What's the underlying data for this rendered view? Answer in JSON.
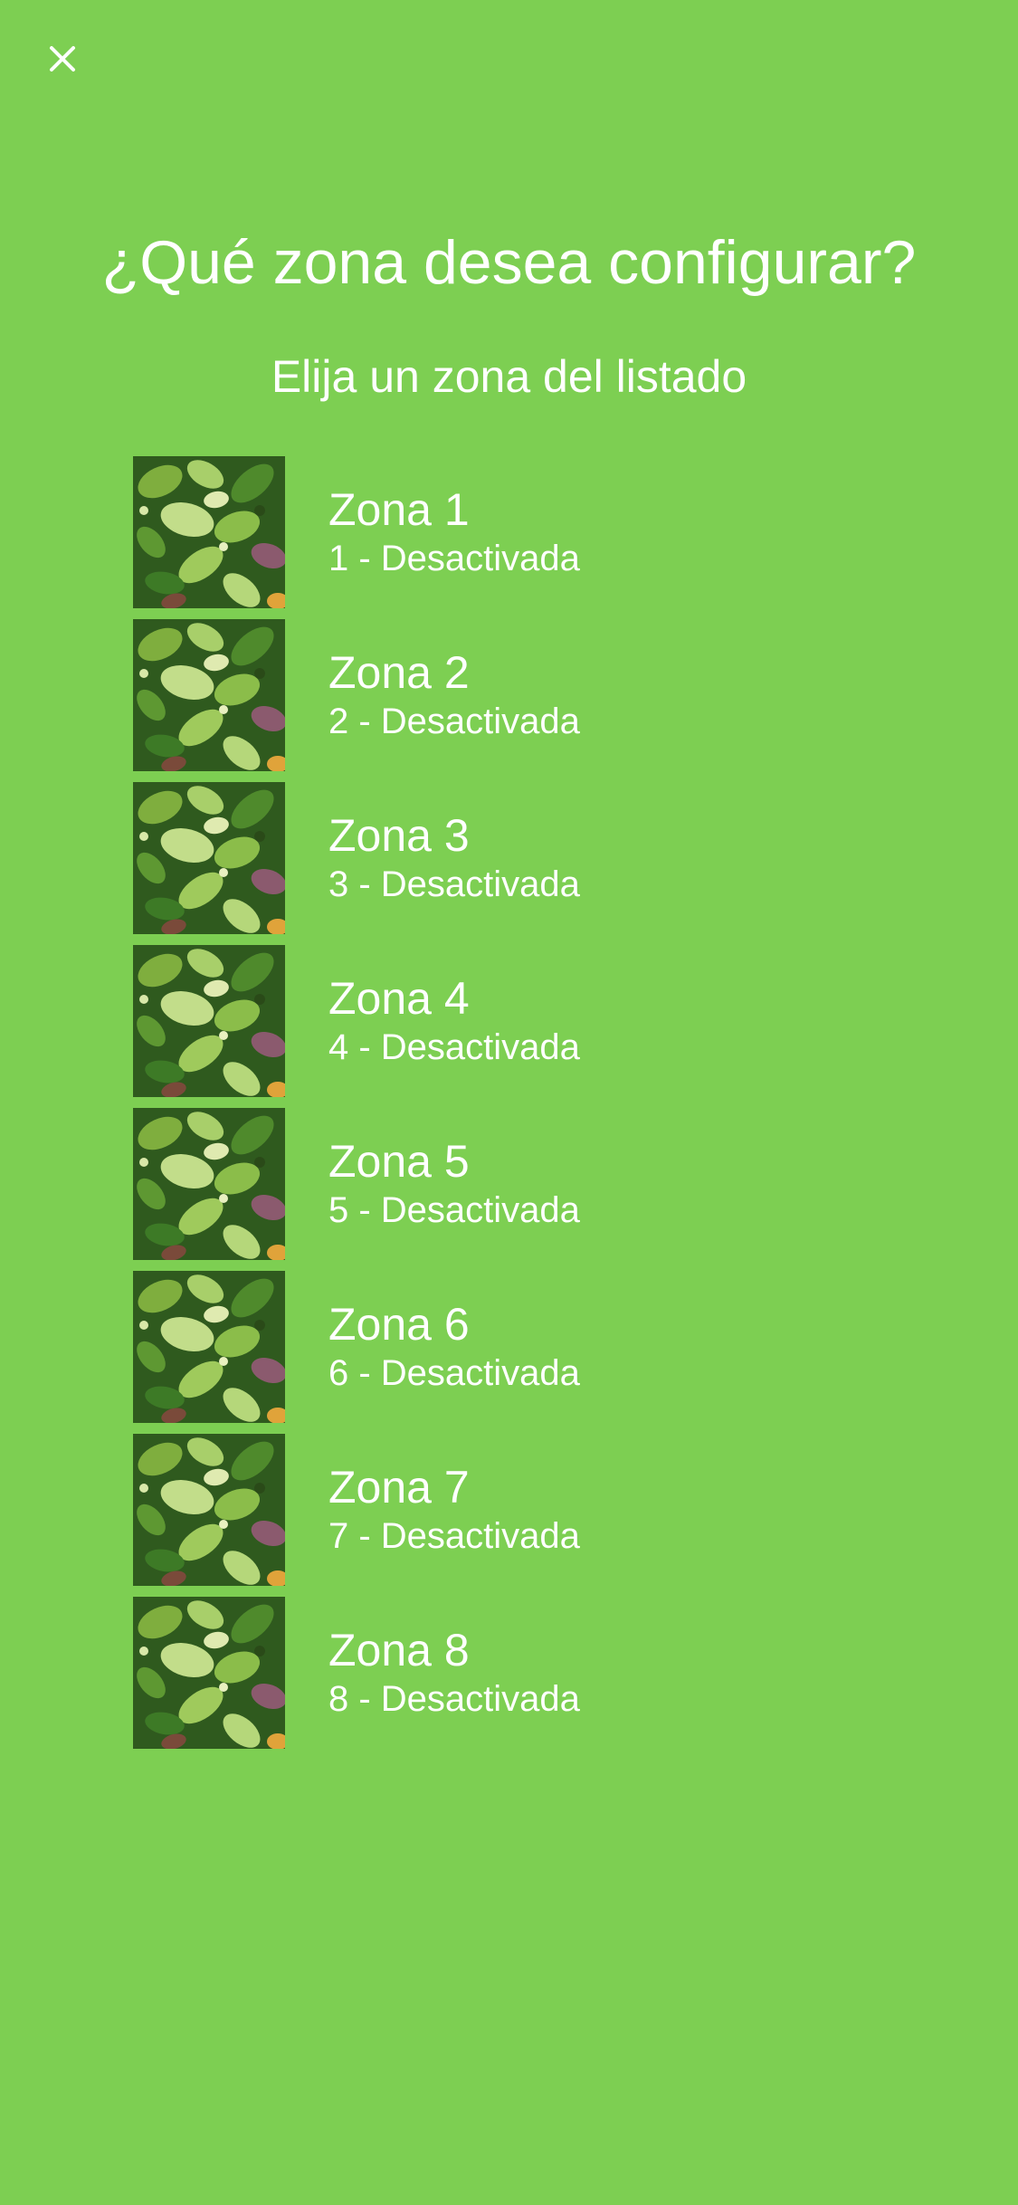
{
  "header": {
    "close_icon": "close-icon",
    "title": "¿Qué zona desea configurar?",
    "subtitle": "Elija un zona del listado"
  },
  "zones": [
    {
      "name": "Zona 1",
      "status": "1 - Desactivada",
      "thumbnail": "foliage-image"
    },
    {
      "name": "Zona 2",
      "status": "2 - Desactivada",
      "thumbnail": "foliage-image"
    },
    {
      "name": "Zona 3",
      "status": "3 - Desactivada",
      "thumbnail": "foliage-image"
    },
    {
      "name": "Zona 4",
      "status": "4 - Desactivada",
      "thumbnail": "foliage-image"
    },
    {
      "name": "Zona 5",
      "status": "5 - Desactivada",
      "thumbnail": "foliage-image"
    },
    {
      "name": "Zona 6",
      "status": "6 - Desactivada",
      "thumbnail": "foliage-image"
    },
    {
      "name": "Zona 7",
      "status": "7 - Desactivada",
      "thumbnail": "foliage-image"
    },
    {
      "name": "Zona 8",
      "status": "8 - Desactivada",
      "thumbnail": "foliage-image"
    }
  ],
  "colors": {
    "background": "#7dcf52",
    "text": "#ffffff"
  }
}
